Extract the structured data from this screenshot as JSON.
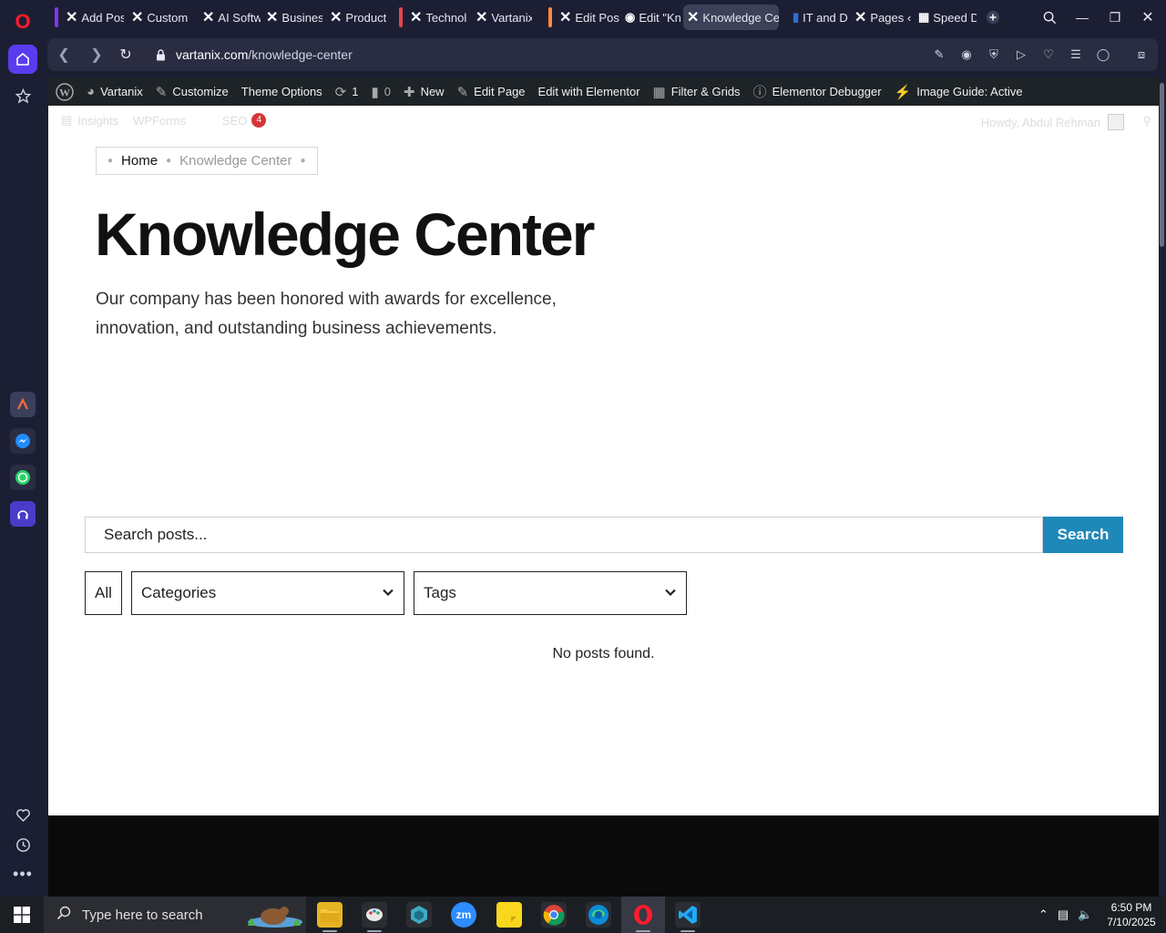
{
  "browser": {
    "tabs": [
      {
        "label": "Add Pos"
      },
      {
        "label": "Custom"
      },
      {
        "label": "AI Softw"
      },
      {
        "label": "Busines"
      },
      {
        "label": "Product"
      },
      {
        "label": "Technol"
      },
      {
        "label": "Vartanix"
      },
      {
        "label": "Edit Pos"
      },
      {
        "label": "Edit \"Kn"
      },
      {
        "label": "Knowledge Ce"
      },
      {
        "label": "IT and D"
      },
      {
        "label": "Pages ‹"
      },
      {
        "label": "Speed D"
      }
    ],
    "active_tab_index": 9,
    "address": {
      "domain": "vartanix.com",
      "path": "/knowledge-center"
    },
    "colors": {
      "frame": "#1c1f33",
      "accent": "#5a3cf0"
    }
  },
  "wp_admin_bar": {
    "items": [
      "Vartanix",
      "Customize",
      "Theme Options",
      "1",
      "0",
      "New",
      "Edit Page",
      "Edit with Elementor",
      "Filter & Grids",
      "Elementor Debugger",
      "Image Guide: Active"
    ],
    "secondary": {
      "insights": "Insights",
      "wpforms": "WPForms",
      "seo": "SEO",
      "seo_count": "4"
    },
    "howdy": "Howdy, Abdul Rehman"
  },
  "page": {
    "breadcrumb": {
      "home": "Home",
      "current": "Knowledge Center"
    },
    "title": "Knowledge Center",
    "subtitle": "Our company has been honored with awards for excellence, innovation, and outstanding business achievements.",
    "search": {
      "placeholder": "Search posts...",
      "button": "Search",
      "button_color": "#1e88b8"
    },
    "filters": {
      "all": "All",
      "categories": "Categories",
      "tags": "Tags"
    },
    "empty_message": "No posts found."
  },
  "taskbar": {
    "search_placeholder": "Type here to search",
    "time": "6:50 PM",
    "date": "7/10/2025"
  }
}
